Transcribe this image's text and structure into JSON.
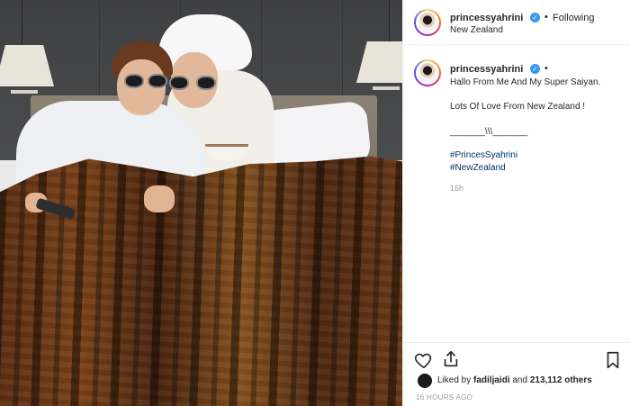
{
  "header": {
    "username": "princessyahrini",
    "verified_mark": "✓",
    "separator": "•",
    "follow_status": "Following",
    "location": "New Zealand"
  },
  "caption": {
    "username": "princessyahrini",
    "verified_mark": "✓",
    "separator": "•",
    "lines": [
      "Hallo From Me And My Super Saiyan.",
      "Lots Of Love From New Zealand !",
      "_______\\\\\\_______"
    ],
    "hashtags": [
      "#PrincesSyahrini",
      "#NewZealand"
    ],
    "time": "16h"
  },
  "actions": {
    "like_icon": "heart-icon",
    "share_icon": "share-icon",
    "save_icon": "bookmark-icon"
  },
  "likes": {
    "prefix": "Liked by",
    "user": "fadiljaidi",
    "middle": "and",
    "count": "213,112 others"
  },
  "timestamp": "16 HOURS AGO",
  "colors": {
    "verified": "#3897f0",
    "hashtag": "#003569",
    "meta": "#999999",
    "text": "#262626"
  }
}
